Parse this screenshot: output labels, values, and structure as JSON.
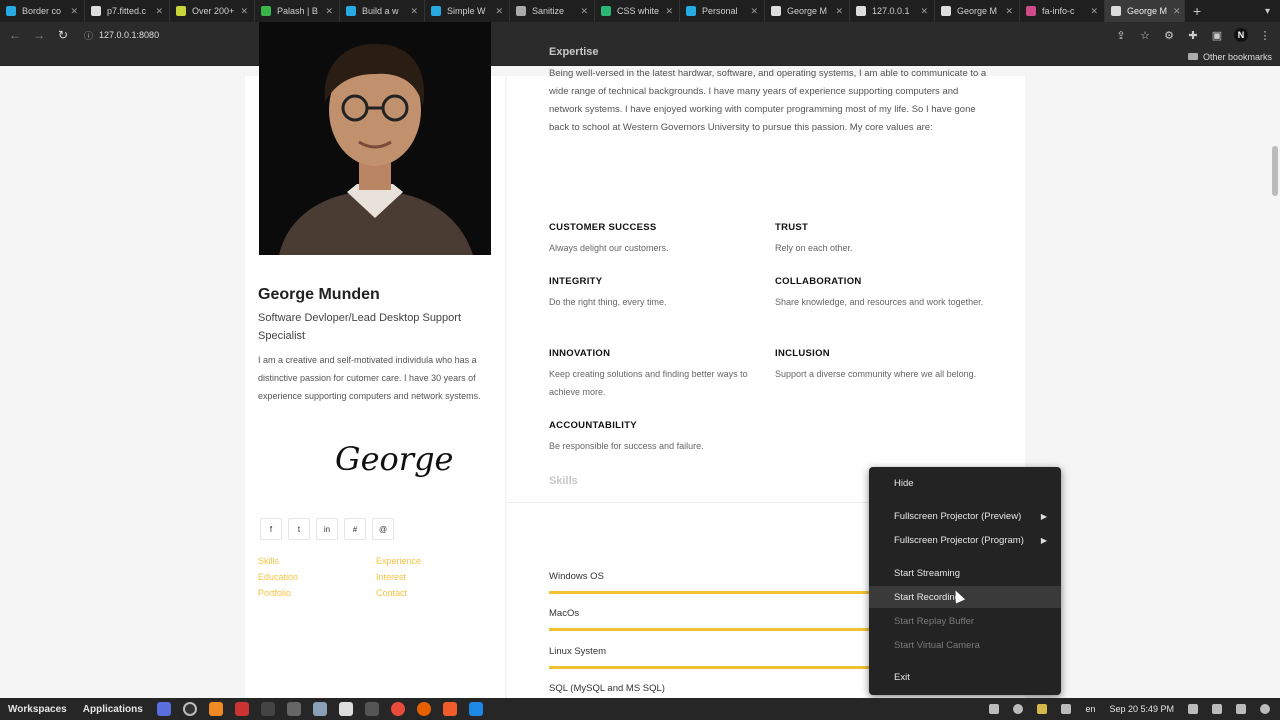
{
  "browser": {
    "tabs": [
      {
        "label": "Border co",
        "color": "#27a9e1"
      },
      {
        "label": "p7.fitted.c",
        "color": "#ddd"
      },
      {
        "label": "Over 200+",
        "color": "#c7d43a"
      },
      {
        "label": "Palash | B",
        "color": "#39b54a"
      },
      {
        "label": "Build a w",
        "color": "#27a9e1"
      },
      {
        "label": "Simple W",
        "color": "#27a9e1"
      },
      {
        "label": "Sanitize",
        "color": "#aaa"
      },
      {
        "label": "CSS white",
        "color": "#2bb673"
      },
      {
        "label": "Personal",
        "color": "#27a9e1"
      },
      {
        "label": "George M",
        "color": "#ddd"
      },
      {
        "label": "127.0.0.1",
        "color": "#ddd"
      },
      {
        "label": "George M",
        "color": "#ddd"
      },
      {
        "label": "fa-info-c",
        "color": "#d04b8a"
      },
      {
        "label": "George M",
        "color": "#ddd"
      }
    ],
    "url": "127.0.0.1:8080",
    "bookmarks_label": "Other bookmarks",
    "profile_initial": "N"
  },
  "profile": {
    "name": "George Munden",
    "role": "Software Devloper/Lead Desktop Support Specialist",
    "bio": "I am a creative and self-motivated individula who has a distinctive passion for cutomer care. I have 30 years of experience supporting computers and network systems.",
    "signature": "George",
    "socials": [
      "f",
      "t",
      "in",
      "#",
      "@"
    ],
    "links": [
      "Skills",
      "Experience",
      "Education",
      "Interest",
      "Portfolio",
      "Contact"
    ]
  },
  "expertise": {
    "title": "Expertise",
    "text": "Being well-versed in the latest hardwar, software, and operating systems, I am able to communicate to a wide range of technical backgrounds. I have many years of experience supporting computers and network systems. I have enjoyed working with computer programming most of my life. So I have gone back to school at Western Governors University to pursue this passion. My core values are:",
    "values": [
      {
        "title": "CUSTOMER SUCCESS",
        "desc": "Always delight our customers."
      },
      {
        "title": "TRUST",
        "desc": "Rely on each other."
      },
      {
        "title": "INTEGRITY",
        "desc": "Do the right thing, every time."
      },
      {
        "title": "COLLABORATION",
        "desc": "Share knowledge, and resources and work together."
      },
      {
        "title": "INNOVATION",
        "desc": "Keep creating solutions and finding better ways to achieve more."
      },
      {
        "title": "INCLUSION",
        "desc": "Support a diverse community where we all belong."
      },
      {
        "title": "ACCOUNTABILITY",
        "desc": "Be responsible for success and failure."
      }
    ]
  },
  "skills": {
    "title": "Skills",
    "items": [
      "Windows OS",
      "MacOs",
      "Linux System",
      "SQL (MySQL and MS SQL)"
    ]
  },
  "context_menu": {
    "items": [
      {
        "label": "Hide",
        "state": "normal"
      },
      {
        "label": "Fullscreen Projector (Preview)",
        "state": "submenu"
      },
      {
        "label": "Fullscreen Projector (Program)",
        "state": "submenu"
      },
      {
        "label": "Start Streaming",
        "state": "normal"
      },
      {
        "label": "Start Recording",
        "state": "highlighted"
      },
      {
        "label": "Start Replay Buffer",
        "state": "disabled"
      },
      {
        "label": "Start Virtual Camera",
        "state": "disabled"
      },
      {
        "label": "Exit",
        "state": "normal"
      }
    ]
  },
  "taskbar": {
    "workspaces": "Workspaces",
    "applications": "Applications",
    "language": "en",
    "clock": "Sep 20   5:49 PM"
  }
}
